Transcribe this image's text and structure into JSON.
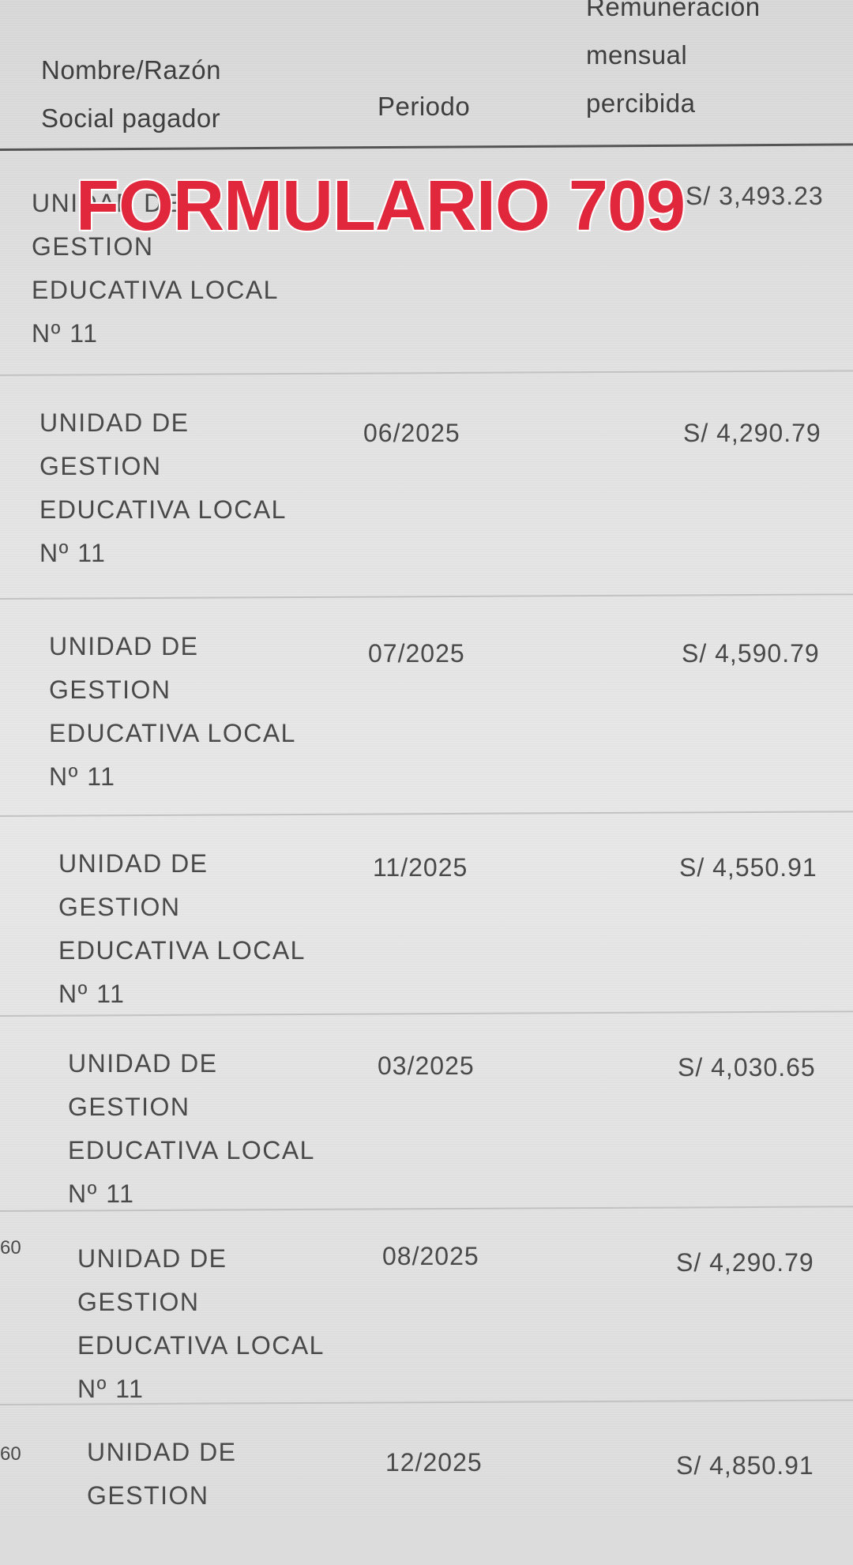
{
  "overlay": {
    "title": "FORMULARIO 709"
  },
  "table": {
    "headers": {
      "name": "Nombre/Razón\nSocial pagador",
      "period": "Periodo",
      "remuneration": "Remuneración\nmensual\npercibida"
    },
    "rows": [
      {
        "name_lines": [
          "UNIDAD DE",
          "GESTION",
          "EDUCATIVA LOCAL",
          "Nº 11"
        ],
        "period": "",
        "amount": "S/ 3,493.23",
        "edge": ""
      },
      {
        "name_lines": [
          "UNIDAD DE",
          "GESTION",
          "EDUCATIVA LOCAL",
          "Nº 11"
        ],
        "period": "06/2025",
        "amount": "S/ 4,290.79",
        "edge": ""
      },
      {
        "name_lines": [
          "UNIDAD DE",
          "GESTION",
          "EDUCATIVA LOCAL",
          "Nº 11"
        ],
        "period": "07/2025",
        "amount": "S/ 4,590.79",
        "edge": ""
      },
      {
        "name_lines": [
          "UNIDAD DE",
          "GESTION",
          "EDUCATIVA LOCAL",
          "Nº 11"
        ],
        "period": "11/2025",
        "amount": "S/ 4,550.91",
        "edge": ""
      },
      {
        "name_lines": [
          "UNIDAD DE",
          "GESTION",
          "EDUCATIVA LOCAL",
          "Nº 11"
        ],
        "period": "03/2025",
        "amount": "S/ 4,030.65",
        "edge": ""
      },
      {
        "name_lines": [
          "UNIDAD DE",
          "GESTION",
          "EDUCATIVA LOCAL",
          "Nº 11"
        ],
        "period": "08/2025",
        "amount": "S/ 4,290.79",
        "edge": "60"
      },
      {
        "name_lines": [
          "UNIDAD DE",
          "GESTION"
        ],
        "period": "12/2025",
        "amount": "S/ 4,850.91",
        "edge": "60"
      }
    ]
  }
}
